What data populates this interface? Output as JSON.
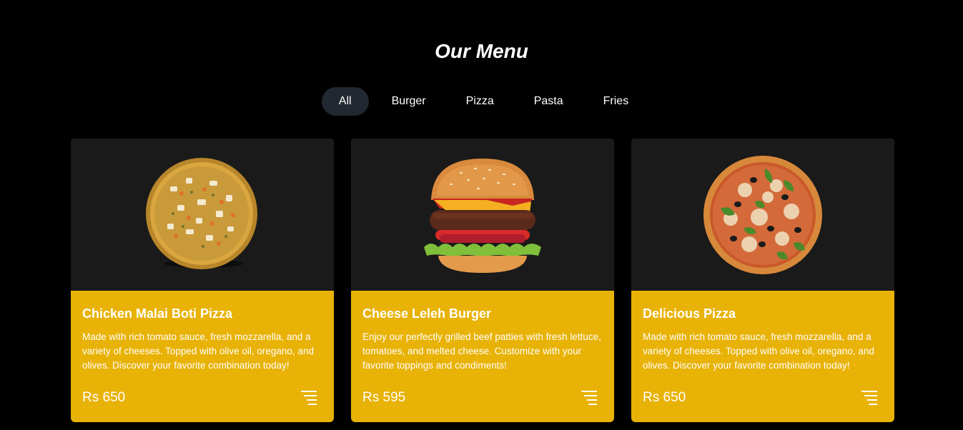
{
  "page": {
    "title": "Our Menu"
  },
  "filters": [
    {
      "label": "All",
      "active": true
    },
    {
      "label": "Burger",
      "active": false
    },
    {
      "label": "Pizza",
      "active": false
    },
    {
      "label": "Pasta",
      "active": false
    },
    {
      "label": "Fries",
      "active": false
    }
  ],
  "colors": {
    "background": "#000000",
    "card_image_bg": "#1a1a1a",
    "card_body_bg": "#e8b206",
    "active_filter_bg": "#222831"
  },
  "cards": [
    {
      "image": "pizza-topped-icon",
      "title": "Chicken Malai Boti Pizza",
      "description": "Made with rich tomato sauce, fresh mozzarella, and a variety of cheeses. Topped with olive oil, oregano, and olives. Discover your favorite combination today!",
      "price": "Rs 650"
    },
    {
      "image": "burger-icon",
      "title": "Cheese Leleh Burger",
      "description": "Enjoy our perfectly grilled beef patties with fresh lettuce, tomatoes, and melted cheese. Customize with your favorite toppings and condiments!",
      "price": "Rs 595"
    },
    {
      "image": "pizza-basil-icon",
      "title": "Delicious Pizza",
      "description": "Made with rich tomato sauce, fresh mozzarella, and a variety of cheeses. Topped with olive oil, oregano, and olives. Discover your favorite combination today!",
      "price": "Rs 650"
    }
  ]
}
